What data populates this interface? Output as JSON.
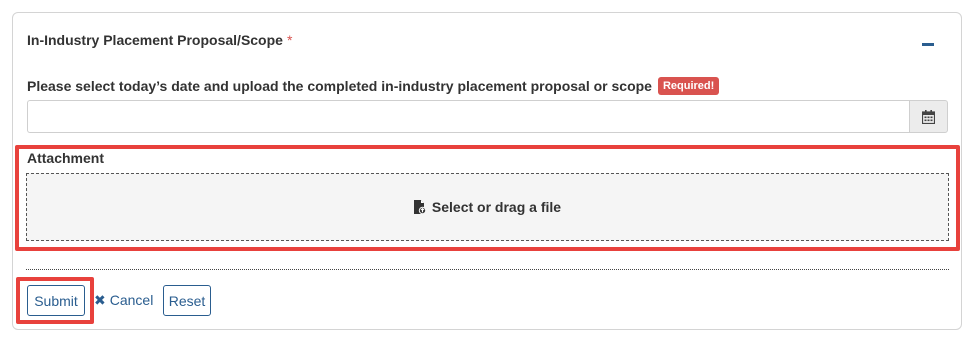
{
  "section": {
    "title": "In-Industry Placement Proposal/Scope",
    "required_star": "*",
    "collapse_icon": "minus-icon"
  },
  "date_field": {
    "question": "Please select today’s date and upload the completed in-industry placement proposal or scope",
    "badge": "Required!",
    "value": "",
    "placeholder": "",
    "calendar_icon": "calendar-icon"
  },
  "attachment": {
    "label": "Attachment",
    "dropzone_text": "Select or drag a file",
    "icon": "file-upload-icon"
  },
  "actions": {
    "submit_label": "Submit",
    "cancel_label": "Cancel",
    "cancel_icon": "close-icon",
    "reset_label": "Reset"
  },
  "colors": {
    "highlight": "#e8413c",
    "accent": "#2a5d8f",
    "badge": "#d9534f"
  }
}
